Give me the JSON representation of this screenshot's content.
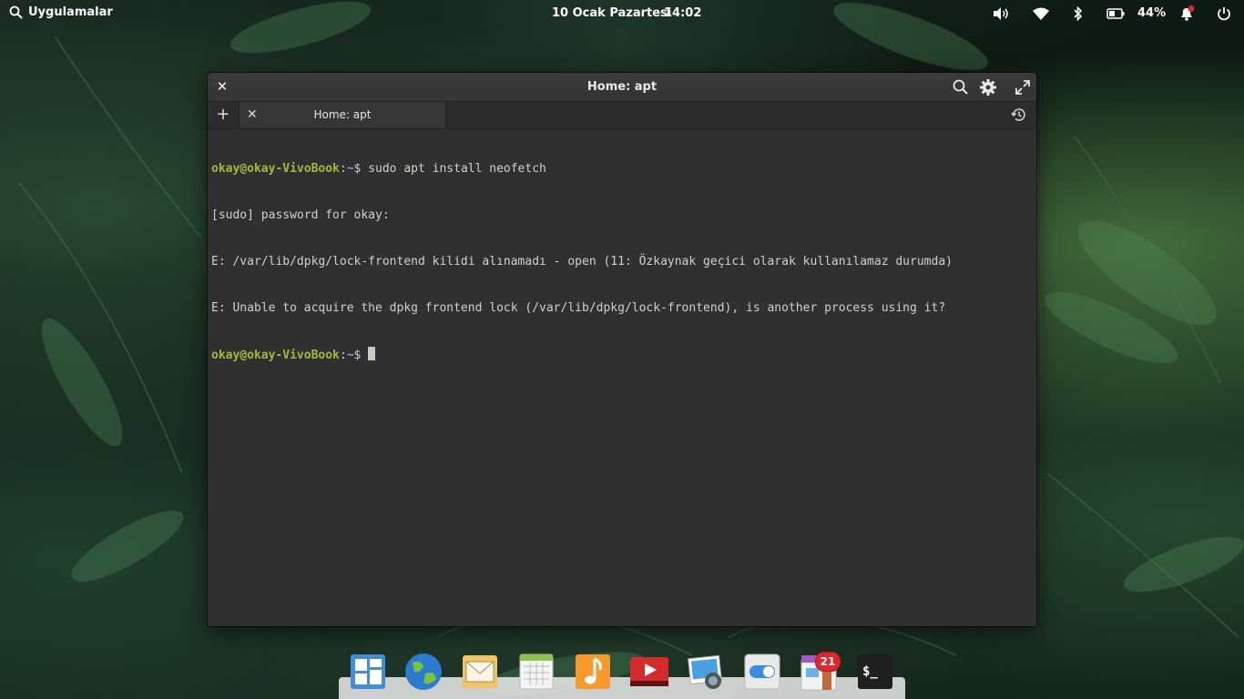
{
  "panel": {
    "apps_label": "Uygulamalar",
    "date": "10 Ocak Pazartesi",
    "time": "14:02",
    "battery_percent": "44%",
    "indicators": [
      "volume-icon",
      "wifi-icon",
      "bluetooth-icon",
      "battery-icon",
      "notifications-icon",
      "power-icon"
    ]
  },
  "window": {
    "title": "Home: apt",
    "tab_label": "Home: apt"
  },
  "terminal": {
    "user_host": "okay@okay-VivoBook",
    "path": "~",
    "cmd1": "$ sudo apt install neofetch",
    "out1": "[sudo] password for okay:",
    "out2": "E: /var/lib/dpkg/lock-frontend kilidi alınamadı - open (11: Özkaynak geçici olarak kullanılamaz durumda)",
    "out3": "E: Unable to acquire the dpkg frontend lock (/var/lib/dpkg/lock-frontend), is another process using it?",
    "prompt2": "$ "
  },
  "dock": {
    "apps": [
      "multitasking-view",
      "web-browser",
      "mail",
      "calendar",
      "music",
      "videos",
      "photos",
      "system-settings",
      "appcenter",
      "terminal"
    ],
    "appcenter_badge": "21"
  }
}
